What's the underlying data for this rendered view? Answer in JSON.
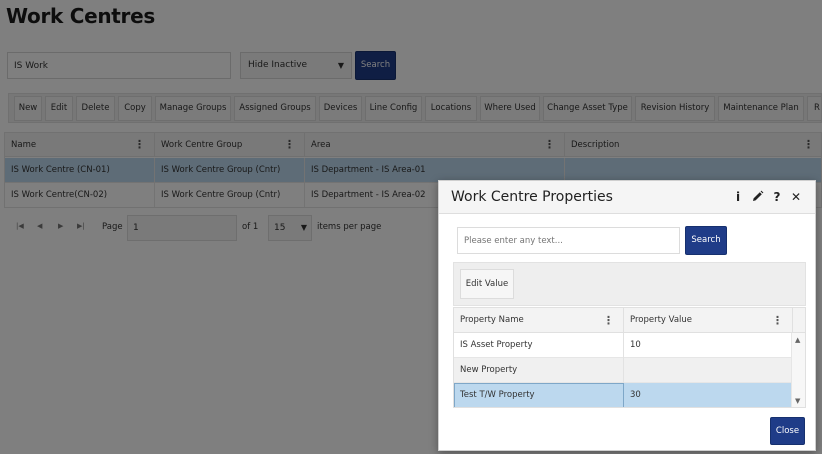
{
  "page": {
    "title": "Work Centres",
    "search_value": "IS Work",
    "filter_selected": "Hide Inactive",
    "search_label": "Search"
  },
  "toolbar": {
    "buttons": [
      "New",
      "Edit",
      "Delete",
      "Copy",
      "Manage Groups",
      "Assigned Groups",
      "Devices",
      "Line Config",
      "Locations",
      "Where Used",
      "Change Asset Type",
      "Revision History",
      "Maintenance Plan",
      "R"
    ]
  },
  "grid": {
    "columns": [
      "Name",
      "Work Centre Group",
      "Area",
      "Description"
    ],
    "rows": [
      {
        "name": "IS Work Centre (CN-01)",
        "group": "IS Work Centre Group (Cntr)",
        "area": "IS Department - IS Area-01",
        "description": ""
      },
      {
        "name": "IS Work Centre(CN-02)",
        "group": "IS Work Centre Group (Cntr)",
        "area": "IS Department - IS Area-02",
        "description": ""
      }
    ],
    "selected_row": 0
  },
  "pager": {
    "page_label": "Page",
    "page_value": "1",
    "of_label": "of 1",
    "page_size": "15",
    "items_per_page_label": "items per page"
  },
  "dialog": {
    "title": "Work Centre Properties",
    "search_placeholder": "Please enter any text...",
    "search_label": "Search",
    "edit_value_label": "Edit Value",
    "columns": [
      "Property Name",
      "Property Value"
    ],
    "rows": [
      {
        "name": "IS Asset Property",
        "value": "10"
      },
      {
        "name": "New Property",
        "value": ""
      },
      {
        "name": "Test T/W Property",
        "value": "30"
      }
    ],
    "close_label": "Close",
    "icons": [
      "info-icon",
      "pencil-icon",
      "help-icon",
      "close-icon"
    ]
  },
  "colors": {
    "primary_button": "#1f3c88",
    "selected_row": "#bcd8ee",
    "overlay": "rgba(0,0,0,0.5)"
  }
}
